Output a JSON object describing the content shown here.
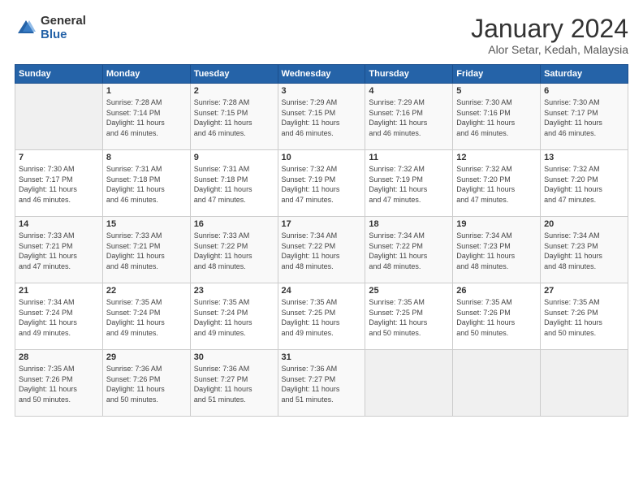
{
  "logo": {
    "general": "General",
    "blue": "Blue"
  },
  "header": {
    "month": "January 2024",
    "location": "Alor Setar, Kedah, Malaysia"
  },
  "days_of_week": [
    "Sunday",
    "Monday",
    "Tuesday",
    "Wednesday",
    "Thursday",
    "Friday",
    "Saturday"
  ],
  "weeks": [
    [
      {
        "day": "",
        "sunrise": "",
        "sunset": "",
        "daylight": ""
      },
      {
        "day": "1",
        "sunrise": "Sunrise: 7:28 AM",
        "sunset": "Sunset: 7:14 PM",
        "daylight": "Daylight: 11 hours and 46 minutes."
      },
      {
        "day": "2",
        "sunrise": "Sunrise: 7:28 AM",
        "sunset": "Sunset: 7:15 PM",
        "daylight": "Daylight: 11 hours and 46 minutes."
      },
      {
        "day": "3",
        "sunrise": "Sunrise: 7:29 AM",
        "sunset": "Sunset: 7:15 PM",
        "daylight": "Daylight: 11 hours and 46 minutes."
      },
      {
        "day": "4",
        "sunrise": "Sunrise: 7:29 AM",
        "sunset": "Sunset: 7:16 PM",
        "daylight": "Daylight: 11 hours and 46 minutes."
      },
      {
        "day": "5",
        "sunrise": "Sunrise: 7:30 AM",
        "sunset": "Sunset: 7:16 PM",
        "daylight": "Daylight: 11 hours and 46 minutes."
      },
      {
        "day": "6",
        "sunrise": "Sunrise: 7:30 AM",
        "sunset": "Sunset: 7:17 PM",
        "daylight": "Daylight: 11 hours and 46 minutes."
      }
    ],
    [
      {
        "day": "7",
        "sunrise": "Sunrise: 7:30 AM",
        "sunset": "Sunset: 7:17 PM",
        "daylight": "Daylight: 11 hours and 46 minutes."
      },
      {
        "day": "8",
        "sunrise": "Sunrise: 7:31 AM",
        "sunset": "Sunset: 7:18 PM",
        "daylight": "Daylight: 11 hours and 46 minutes."
      },
      {
        "day": "9",
        "sunrise": "Sunrise: 7:31 AM",
        "sunset": "Sunset: 7:18 PM",
        "daylight": "Daylight: 11 hours and 47 minutes."
      },
      {
        "day": "10",
        "sunrise": "Sunrise: 7:32 AM",
        "sunset": "Sunset: 7:19 PM",
        "daylight": "Daylight: 11 hours and 47 minutes."
      },
      {
        "day": "11",
        "sunrise": "Sunrise: 7:32 AM",
        "sunset": "Sunset: 7:19 PM",
        "daylight": "Daylight: 11 hours and 47 minutes."
      },
      {
        "day": "12",
        "sunrise": "Sunrise: 7:32 AM",
        "sunset": "Sunset: 7:20 PM",
        "daylight": "Daylight: 11 hours and 47 minutes."
      },
      {
        "day": "13",
        "sunrise": "Sunrise: 7:32 AM",
        "sunset": "Sunset: 7:20 PM",
        "daylight": "Daylight: 11 hours and 47 minutes."
      }
    ],
    [
      {
        "day": "14",
        "sunrise": "Sunrise: 7:33 AM",
        "sunset": "Sunset: 7:21 PM",
        "daylight": "Daylight: 11 hours and 47 minutes."
      },
      {
        "day": "15",
        "sunrise": "Sunrise: 7:33 AM",
        "sunset": "Sunset: 7:21 PM",
        "daylight": "Daylight: 11 hours and 48 minutes."
      },
      {
        "day": "16",
        "sunrise": "Sunrise: 7:33 AM",
        "sunset": "Sunset: 7:22 PM",
        "daylight": "Daylight: 11 hours and 48 minutes."
      },
      {
        "day": "17",
        "sunrise": "Sunrise: 7:34 AM",
        "sunset": "Sunset: 7:22 PM",
        "daylight": "Daylight: 11 hours and 48 minutes."
      },
      {
        "day": "18",
        "sunrise": "Sunrise: 7:34 AM",
        "sunset": "Sunset: 7:22 PM",
        "daylight": "Daylight: 11 hours and 48 minutes."
      },
      {
        "day": "19",
        "sunrise": "Sunrise: 7:34 AM",
        "sunset": "Sunset: 7:23 PM",
        "daylight": "Daylight: 11 hours and 48 minutes."
      },
      {
        "day": "20",
        "sunrise": "Sunrise: 7:34 AM",
        "sunset": "Sunset: 7:23 PM",
        "daylight": "Daylight: 11 hours and 48 minutes."
      }
    ],
    [
      {
        "day": "21",
        "sunrise": "Sunrise: 7:34 AM",
        "sunset": "Sunset: 7:24 PM",
        "daylight": "Daylight: 11 hours and 49 minutes."
      },
      {
        "day": "22",
        "sunrise": "Sunrise: 7:35 AM",
        "sunset": "Sunset: 7:24 PM",
        "daylight": "Daylight: 11 hours and 49 minutes."
      },
      {
        "day": "23",
        "sunrise": "Sunrise: 7:35 AM",
        "sunset": "Sunset: 7:24 PM",
        "daylight": "Daylight: 11 hours and 49 minutes."
      },
      {
        "day": "24",
        "sunrise": "Sunrise: 7:35 AM",
        "sunset": "Sunset: 7:25 PM",
        "daylight": "Daylight: 11 hours and 49 minutes."
      },
      {
        "day": "25",
        "sunrise": "Sunrise: 7:35 AM",
        "sunset": "Sunset: 7:25 PM",
        "daylight": "Daylight: 11 hours and 50 minutes."
      },
      {
        "day": "26",
        "sunrise": "Sunrise: 7:35 AM",
        "sunset": "Sunset: 7:26 PM",
        "daylight": "Daylight: 11 hours and 50 minutes."
      },
      {
        "day": "27",
        "sunrise": "Sunrise: 7:35 AM",
        "sunset": "Sunset: 7:26 PM",
        "daylight": "Daylight: 11 hours and 50 minutes."
      }
    ],
    [
      {
        "day": "28",
        "sunrise": "Sunrise: 7:35 AM",
        "sunset": "Sunset: 7:26 PM",
        "daylight": "Daylight: 11 hours and 50 minutes."
      },
      {
        "day": "29",
        "sunrise": "Sunrise: 7:36 AM",
        "sunset": "Sunset: 7:26 PM",
        "daylight": "Daylight: 11 hours and 50 minutes."
      },
      {
        "day": "30",
        "sunrise": "Sunrise: 7:36 AM",
        "sunset": "Sunset: 7:27 PM",
        "daylight": "Daylight: 11 hours and 51 minutes."
      },
      {
        "day": "31",
        "sunrise": "Sunrise: 7:36 AM",
        "sunset": "Sunset: 7:27 PM",
        "daylight": "Daylight: 11 hours and 51 minutes."
      },
      {
        "day": "",
        "sunrise": "",
        "sunset": "",
        "daylight": ""
      },
      {
        "day": "",
        "sunrise": "",
        "sunset": "",
        "daylight": ""
      },
      {
        "day": "",
        "sunrise": "",
        "sunset": "",
        "daylight": ""
      }
    ]
  ]
}
